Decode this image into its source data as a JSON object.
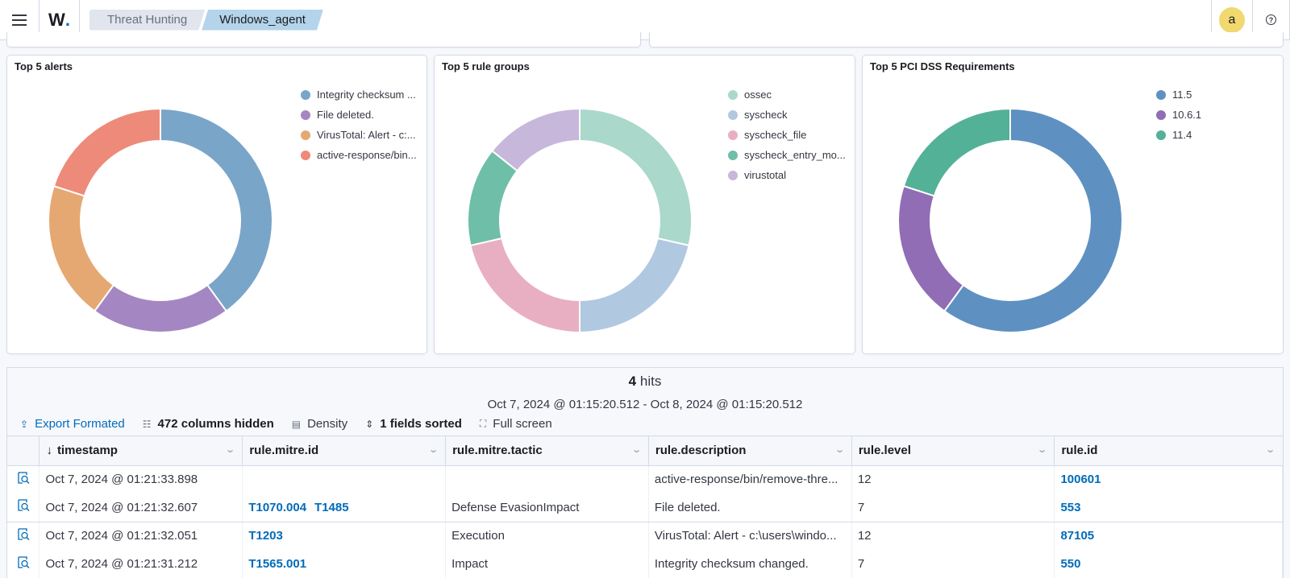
{
  "header": {
    "menu_icon": "hamburger-menu-icon",
    "logo_text": "W",
    "logo_dot": ".",
    "breadcrumbs": [
      "Threat Hunting",
      "Windows_agent"
    ],
    "avatar_letter": "a",
    "help_glyph": "?"
  },
  "panels": [
    {
      "title": "Top 5 alerts",
      "legend": [
        {
          "label": "Integrity checksum ...",
          "color": "#79a5c9"
        },
        {
          "label": "File deleted.",
          "color": "#a487c2"
        },
        {
          "label": "VirusTotal: Alert - c:...",
          "color": "#e5a872"
        },
        {
          "label": "active-response/bin...",
          "color": "#ee8a79"
        }
      ]
    },
    {
      "title": "Top 5 rule groups",
      "legend": [
        {
          "label": "ossec",
          "color": "#aad8cb"
        },
        {
          "label": "syscheck",
          "color": "#b1c8e1"
        },
        {
          "label": "syscheck_file",
          "color": "#e8afc2"
        },
        {
          "label": "syscheck_entry_mo...",
          "color": "#6ebea8"
        },
        {
          "label": "virustotal",
          "color": "#c7b7db"
        }
      ]
    },
    {
      "title": "Top 5 PCI DSS Requirements",
      "legend": [
        {
          "label": "11.5",
          "color": "#5e91c1"
        },
        {
          "label": "10.6.1",
          "color": "#906db5"
        },
        {
          "label": "11.4",
          "color": "#53b198"
        }
      ]
    }
  ],
  "chart_data": [
    {
      "type": "pie",
      "title": "Top 5 alerts",
      "donut": true,
      "legend_position": "top-right",
      "categories": [
        "Integrity checksum changed.",
        "File deleted.",
        "VirusTotal: Alert - c:\\users\\windo...",
        "active-response/bin/remove-thre..."
      ],
      "values": [
        2,
        1,
        1,
        1
      ]
    },
    {
      "type": "pie",
      "title": "Top 5 rule groups",
      "donut": true,
      "legend_position": "top-right",
      "categories": [
        "ossec",
        "syscheck",
        "syscheck_file",
        "syscheck_entry_mo...",
        "virustotal"
      ],
      "values": [
        4,
        3,
        3,
        2,
        2
      ]
    },
    {
      "type": "pie",
      "title": "Top 5 PCI DSS Requirements",
      "donut": true,
      "legend_position": "top-right",
      "categories": [
        "11.5",
        "10.6.1",
        "11.4"
      ],
      "values": [
        3,
        1,
        1
      ]
    }
  ],
  "discover": {
    "hits_count": "4",
    "hits_label": " hits",
    "time_range": "Oct 7, 2024 @ 01:15:20.512 - Oct 8, 2024 @ 01:15:20.512",
    "toolbar": {
      "export": "Export Formated",
      "columns_hidden": "472 columns hidden",
      "density": "Density",
      "fields_sorted": "1 fields sorted",
      "full_screen": "Full screen"
    },
    "columns": [
      "timestamp",
      "rule.mitre.id",
      "rule.mitre.tactic",
      "rule.description",
      "rule.level",
      "rule.id"
    ],
    "sort_indicator": "↓",
    "rows": [
      {
        "timestamp": "Oct 7, 2024 @ 01:21:33.898",
        "mitre_ids": [],
        "tactic": "",
        "description": "active-response/bin/remove-thre...",
        "level": "12",
        "rule_id": "100601"
      },
      {
        "timestamp": "Oct 7, 2024 @ 01:21:32.607",
        "mitre_ids": [
          "T1070.004",
          "T1485"
        ],
        "tactic": "Defense EvasionImpact",
        "description": "File deleted.",
        "level": "7",
        "rule_id": "553"
      },
      {
        "timestamp": "Oct 7, 2024 @ 01:21:32.051",
        "mitre_ids": [
          "T1203"
        ],
        "tactic": "Execution",
        "description": "VirusTotal: Alert - c:\\users\\windo...",
        "level": "12",
        "rule_id": "87105"
      },
      {
        "timestamp": "Oct 7, 2024 @ 01:21:31.212",
        "mitre_ids": [
          "T1565.001"
        ],
        "tactic": "Impact",
        "description": "Integrity checksum changed.",
        "level": "7",
        "rule_id": "550"
      }
    ]
  }
}
